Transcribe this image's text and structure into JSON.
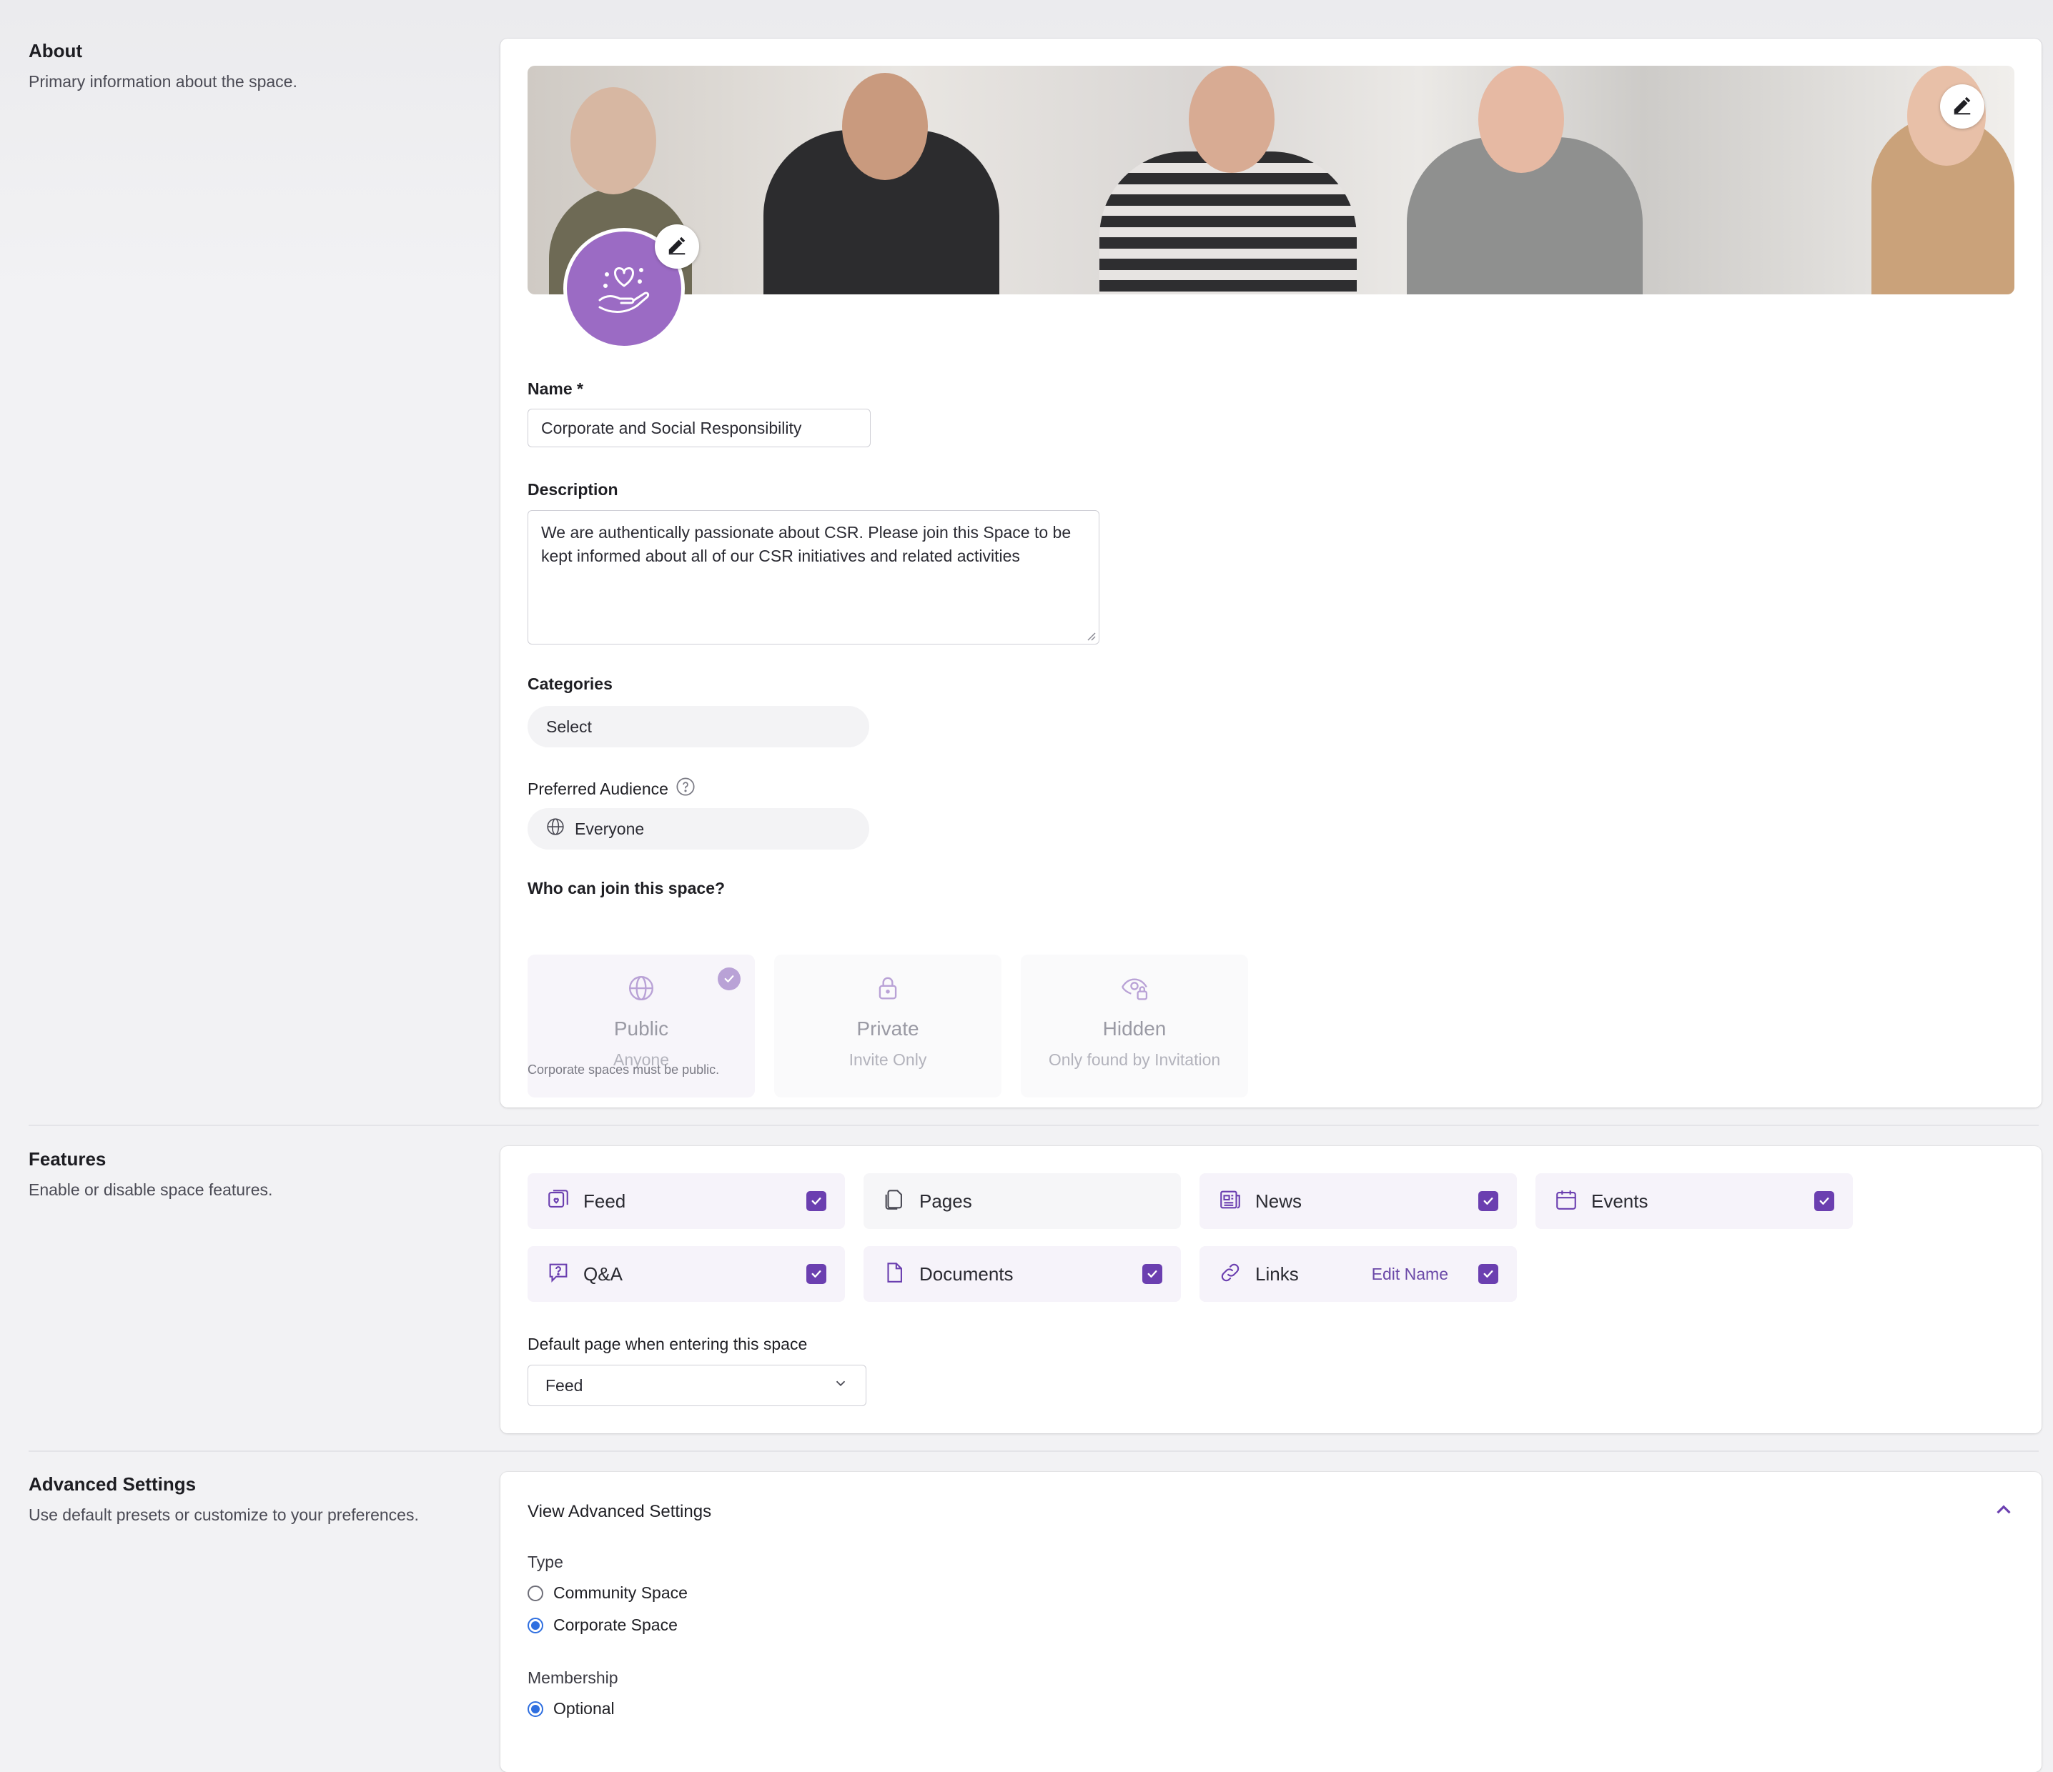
{
  "colors": {
    "accent": "#6b3fb0",
    "avatar": "#9b6bc4",
    "radio": "#2f6fe0"
  },
  "about": {
    "title": "About",
    "subtitle": "Primary information about the space.",
    "banner_edit_icon": "pencil-icon",
    "avatar_icon": "heart-in-hand-icon",
    "name_label": "Name *",
    "name_value": "Corporate and Social Responsibility",
    "description_label": "Description",
    "description_value": "We are authentically passionate about CSR. Please join this Space to be kept informed about all of our CSR initiatives and related activities",
    "categories_label": "Categories",
    "categories_value": "Select",
    "audience_label": "Preferred Audience",
    "audience_value": "Everyone",
    "join_label": "Who can join this space?",
    "join_options": [
      {
        "title": "Public",
        "subtitle": "Anyone",
        "icon": "globe-icon",
        "selected": true
      },
      {
        "title": "Private",
        "subtitle": "Invite Only",
        "icon": "lock-icon",
        "selected": false
      },
      {
        "title": "Hidden",
        "subtitle": "Only found by Invitation",
        "icon": "eye-lock-icon",
        "selected": false
      }
    ],
    "join_hint": "Corporate spaces must be public."
  },
  "features": {
    "title": "Features",
    "subtitle": "Enable or disable space features.",
    "items": [
      {
        "name": "Feed",
        "icon": "feed-icon",
        "checked": true
      },
      {
        "name": "Pages",
        "icon": "pages-icon",
        "checked": false
      },
      {
        "name": "News",
        "icon": "news-icon",
        "checked": true
      },
      {
        "name": "Events",
        "icon": "calendar-icon",
        "checked": true
      },
      {
        "name": "Q&A",
        "icon": "question-icon",
        "checked": true
      },
      {
        "name": "Documents",
        "icon": "document-icon",
        "checked": true
      },
      {
        "name": "Links",
        "icon": "link-icon",
        "checked": true,
        "edit_label": "Edit Name"
      }
    ],
    "default_page_label": "Default page when entering this space",
    "default_page_value": "Feed"
  },
  "advanced": {
    "title": "Advanced Settings",
    "subtitle": "Use default presets or customize to your preferences.",
    "toggle_label": "View Advanced Settings",
    "type_label": "Type",
    "type_options": [
      {
        "label": "Community Space",
        "selected": false
      },
      {
        "label": "Corporate Space",
        "selected": true
      }
    ],
    "membership_label": "Membership",
    "membership_options": [
      {
        "label": "Optional",
        "selected": true
      }
    ]
  }
}
